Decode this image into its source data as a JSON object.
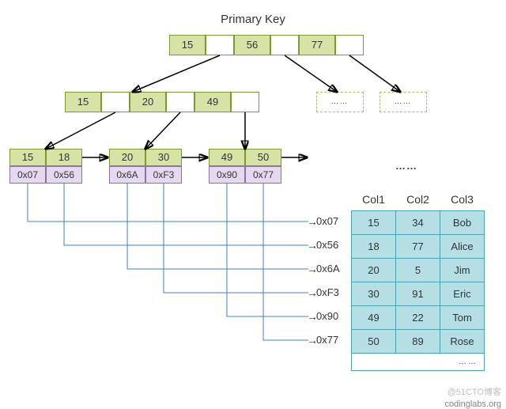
{
  "title": "Primary Key",
  "root": {
    "keys": [
      "15",
      "56",
      "77"
    ]
  },
  "level2": {
    "keys": [
      "15",
      "20",
      "49"
    ]
  },
  "dashed_placeholder": "……",
  "leaves": [
    {
      "keys": [
        "15",
        "18"
      ],
      "ptrs": [
        "0x07",
        "0x56"
      ]
    },
    {
      "keys": [
        "20",
        "30"
      ],
      "ptrs": [
        "0x6A",
        "0xF3"
      ]
    },
    {
      "keys": [
        "49",
        "50"
      ],
      "ptrs": [
        "0x90",
        "0x77"
      ]
    }
  ],
  "leaf_dots": "……",
  "ptr_arrow": "→",
  "ptr_labels": [
    "0x07",
    "0x56",
    "0x6A",
    "0xF3",
    "0x90",
    "0x77"
  ],
  "table": {
    "headers": [
      "Col1",
      "Col2",
      "Col3"
    ],
    "rows": [
      [
        "15",
        "34",
        "Bob"
      ],
      [
        "18",
        "77",
        "Alice"
      ],
      [
        "20",
        "5",
        "Jim"
      ],
      [
        "30",
        "91",
        "Eric"
      ],
      [
        "49",
        "22",
        "Tom"
      ],
      [
        "50",
        "89",
        "Rose"
      ]
    ],
    "empty_row": "……"
  },
  "watermark_top": "@51CTO博客",
  "watermark_bottom": "codinglabs.org"
}
